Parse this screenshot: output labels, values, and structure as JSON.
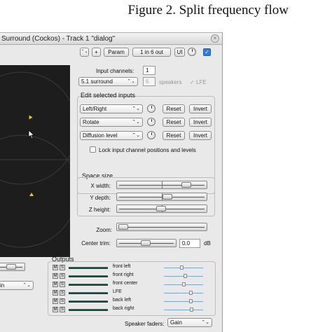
{
  "caption": "Figure 2. Split frequency flow",
  "window": {
    "title": "Surround (Cockos) - Track 1 \"dialog\"",
    "close_glyph": "×"
  },
  "toolbar": {
    "arrows_glyph": "⌃⌄",
    "add_label": "+",
    "param_label": "Param",
    "io_label": "1 in 6 out",
    "ui_label": "UI",
    "check_glyph": "✓"
  },
  "input": {
    "channels_label": "Input channels:",
    "channels_value": "1",
    "layout_value": "5.1 surround",
    "speakers_value": "6",
    "speakers_label": "speakers",
    "lfe_label": "LFE"
  },
  "edit": {
    "title": "Edit selected inputs",
    "rows": [
      {
        "param": "Left/Right",
        "reset": "Reset",
        "invert": "Invert"
      },
      {
        "param": "Rotate",
        "reset": "Reset",
        "invert": "Invert"
      },
      {
        "param": "Diffusion level",
        "reset": "Reset",
        "invert": "Invert"
      }
    ],
    "lock_label": "Lock input channel positions and levels"
  },
  "space": {
    "title": "Space size",
    "sliders": [
      {
        "label": "X width:",
        "value": 0.82
      },
      {
        "label": "Y depth:",
        "value": 0.58
      },
      {
        "label": "Z height:",
        "value": 0.5
      }
    ]
  },
  "zoom": {
    "label": "Zoom:",
    "value": 0.02
  },
  "center_trim": {
    "label": "Center trim:",
    "value": 0.5,
    "readout": "0.0",
    "unit": "dB"
  },
  "left_combo": {
    "value": "in"
  },
  "outputs": {
    "title": "Outputs",
    "m": "M",
    "s": "S",
    "rows": [
      {
        "name": "front left",
        "level": 0.45
      },
      {
        "name": "front right",
        "level": 0.55
      },
      {
        "name": "front center",
        "level": 0.5
      },
      {
        "name": "LFE",
        "level": 0.7
      },
      {
        "name": "back left",
        "level": 0.7
      },
      {
        "name": "back right",
        "level": 0.72
      }
    ]
  },
  "speaker_faders": {
    "label": "Speaker faders:",
    "value": "Gain"
  },
  "colors": {
    "pad": "#1d1d1d",
    "marker": "#e8c800",
    "accent": "#2e7ae6"
  }
}
